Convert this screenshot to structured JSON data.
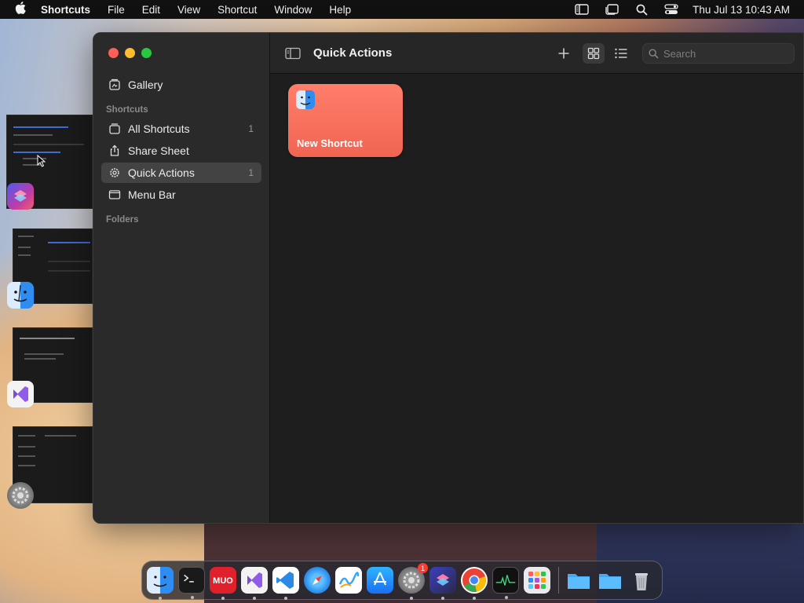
{
  "menubar": {
    "app_name": "Shortcuts",
    "menus": [
      "File",
      "Edit",
      "View",
      "Shortcut",
      "Window",
      "Help"
    ],
    "clock": "Thu Jul 13  10:43 AM",
    "status_icons": [
      "sidebar-status-icon",
      "stage-manager-icon",
      "spotlight-search-icon",
      "control-center-icon"
    ]
  },
  "sidebar": {
    "gallery_label": "Gallery",
    "shortcuts_header": "Shortcuts",
    "items": [
      {
        "label": "All Shortcuts",
        "count": "1",
        "icon": "all-shortcuts-icon"
      },
      {
        "label": "Share Sheet",
        "count": "",
        "icon": "share-icon"
      },
      {
        "label": "Quick Actions",
        "count": "1",
        "icon": "gear-icon",
        "selected": true
      },
      {
        "label": "Menu Bar",
        "count": "",
        "icon": "menu-bar-icon"
      }
    ],
    "folders_header": "Folders"
  },
  "toolbar": {
    "title": "Quick Actions",
    "search_placeholder": "Search"
  },
  "content": {
    "shortcuts": [
      {
        "name": "New Shortcut",
        "color": "#f56b57",
        "icon": "finder-icon"
      }
    ]
  },
  "colors": {
    "accent_card": "#f56b57",
    "selection": "#434343",
    "close": "#ff5f57",
    "minimize": "#febc2e",
    "maximize": "#28c840"
  },
  "dock": {
    "apps": [
      "Finder",
      "Terminal",
      "MUO",
      "Visual Studio",
      "VS Code",
      "Safari",
      "Freeform",
      "App Store",
      "System Settings",
      "Shortcuts",
      "Chrome",
      "Activity Monitor",
      "Launchpad"
    ],
    "badge_settings": "1",
    "others": [
      "Documents folder",
      "Downloads folder",
      "Trash"
    ]
  }
}
